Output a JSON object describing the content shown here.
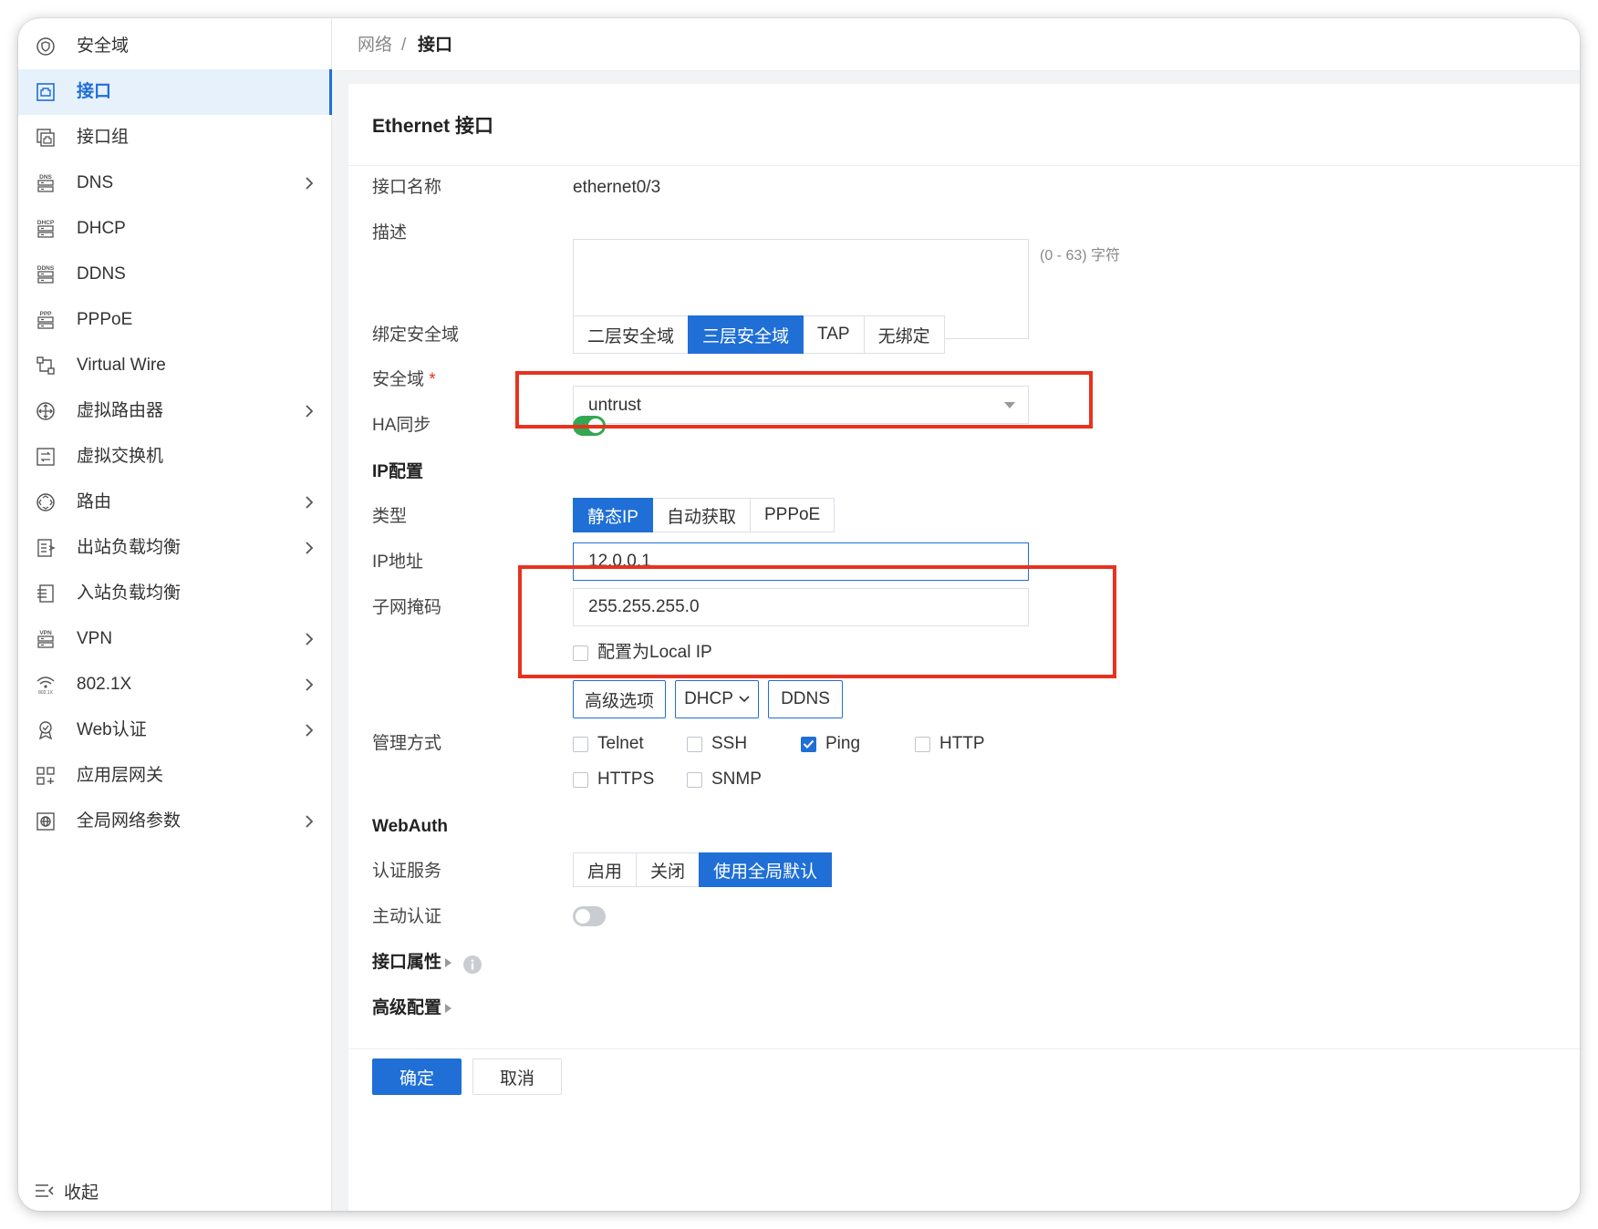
{
  "sidebar": {
    "items": [
      {
        "label": "安全域",
        "icon": "shield-icon",
        "arrow": false,
        "active": false
      },
      {
        "label": "接口",
        "icon": "interface-icon",
        "arrow": false,
        "active": true
      },
      {
        "label": "接口组",
        "icon": "interface-group-icon",
        "arrow": false,
        "active": false
      },
      {
        "label": "DNS",
        "icon": "dns-icon",
        "arrow": true,
        "active": false
      },
      {
        "label": "DHCP",
        "icon": "dhcp-icon",
        "arrow": false,
        "active": false
      },
      {
        "label": "DDNS",
        "icon": "ddns-icon",
        "arrow": false,
        "active": false
      },
      {
        "label": "PPPoE",
        "icon": "pppoe-icon",
        "arrow": false,
        "active": false
      },
      {
        "label": "Virtual Wire",
        "icon": "virtual-wire-icon",
        "arrow": false,
        "active": false
      },
      {
        "label": "虚拟路由器",
        "icon": "virtual-router-icon",
        "arrow": true,
        "active": false
      },
      {
        "label": "虚拟交换机",
        "icon": "virtual-switch-icon",
        "arrow": false,
        "active": false
      },
      {
        "label": "路由",
        "icon": "route-icon",
        "arrow": true,
        "active": false
      },
      {
        "label": "出站负载均衡",
        "icon": "outbound-lb-icon",
        "arrow": true,
        "active": false
      },
      {
        "label": "入站负载均衡",
        "icon": "inbound-lb-icon",
        "arrow": false,
        "active": false
      },
      {
        "label": "VPN",
        "icon": "vpn-icon",
        "arrow": true,
        "active": false
      },
      {
        "label": "802.1X",
        "icon": "wifi-8021x-icon",
        "arrow": true,
        "active": false
      },
      {
        "label": "Web认证",
        "icon": "web-auth-icon",
        "arrow": true,
        "active": false
      },
      {
        "label": "应用层网关",
        "icon": "app-gateway-icon",
        "arrow": false,
        "active": false
      },
      {
        "label": "全局网络参数",
        "icon": "global-params-icon",
        "arrow": true,
        "active": false
      }
    ],
    "collapse_label": "收起"
  },
  "breadcrumb": {
    "root": "网络",
    "separator": "/",
    "current": "接口"
  },
  "panel": {
    "title": "Ethernet 接口",
    "fields": {
      "name_label": "接口名称",
      "name_value": "ethernet0/3",
      "desc_label": "描述",
      "desc_value": "",
      "desc_hint": "(0 - 63) 字符",
      "bind_label": "绑定安全域",
      "bind_options": [
        "二层安全域",
        "三层安全域",
        "TAP",
        "无绑定"
      ],
      "bind_selected": "三层安全域",
      "zone_label": "安全域",
      "zone_required": "*",
      "zone_value": "untrust",
      "ha_label": "HA同步",
      "ha_on": true
    },
    "ip": {
      "section": "IP配置",
      "type_label": "类型",
      "type_options": [
        "静态IP",
        "自动获取",
        "PPPoE"
      ],
      "type_selected": "静态IP",
      "ip_label": "IP地址",
      "ip_value": "12.0.0.1",
      "mask_label": "子网掩码",
      "mask_value": "255.255.255.0",
      "local_ip_label": "配置为Local IP",
      "local_ip_checked": false,
      "buttons": {
        "advanced": "高级选项",
        "dhcp": "DHCP",
        "ddns": "DDNS"
      }
    },
    "mgmt": {
      "label": "管理方式",
      "options": [
        {
          "label": "Telnet",
          "checked": false
        },
        {
          "label": "SSH",
          "checked": false
        },
        {
          "label": "Ping",
          "checked": true
        },
        {
          "label": "HTTP",
          "checked": false
        },
        {
          "label": "HTTPS",
          "checked": false
        },
        {
          "label": "SNMP",
          "checked": false
        }
      ]
    },
    "webauth": {
      "section": "WebAuth",
      "service_label": "认证服务",
      "service_options": [
        "启用",
        "关闭",
        "使用全局默认"
      ],
      "service_selected": "使用全局默认",
      "active_label": "主动认证",
      "active_on": false
    },
    "collapsibles": {
      "interface_props": "接口属性",
      "advanced_config": "高级配置"
    },
    "footer": {
      "confirm": "确定",
      "cancel": "取消"
    }
  },
  "colors": {
    "primary": "#1f6fd6",
    "toggle_on": "#32a852",
    "highlight": "#e8321e"
  }
}
